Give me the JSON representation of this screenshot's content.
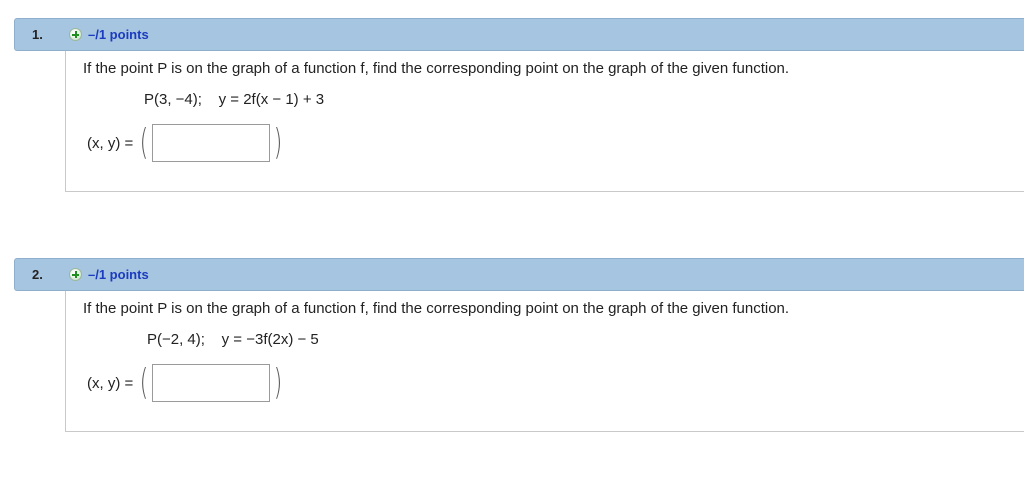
{
  "questions": [
    {
      "number": "1.",
      "points": "–/1 points",
      "prompt": "If the point P is on the graph of a function f, find the corresponding point on the graph of the given function.",
      "given_point": "P(3, −4);",
      "given_function": "y = 2f(x − 1) + 3",
      "answer_label": "(x, y) =",
      "answer_value": "",
      "open_paren": "(",
      "close_paren": ")"
    },
    {
      "number": "2.",
      "points": "–/1 points",
      "prompt": "If the point P is on the graph of a function f, find the corresponding point on the graph of the given function.",
      "given_point": "P(−2, 4);",
      "given_function": "y = −3f(2x) − 5",
      "answer_label": "(x, y) =",
      "answer_value": "",
      "open_paren": "(",
      "close_paren": ")"
    }
  ],
  "icons": {
    "points_toggle": "plus-circle-icon"
  },
  "colors": {
    "header_bg": "#a6c5e0",
    "points_text": "#1c3bbf",
    "plus_green": "#1e8f1e"
  }
}
